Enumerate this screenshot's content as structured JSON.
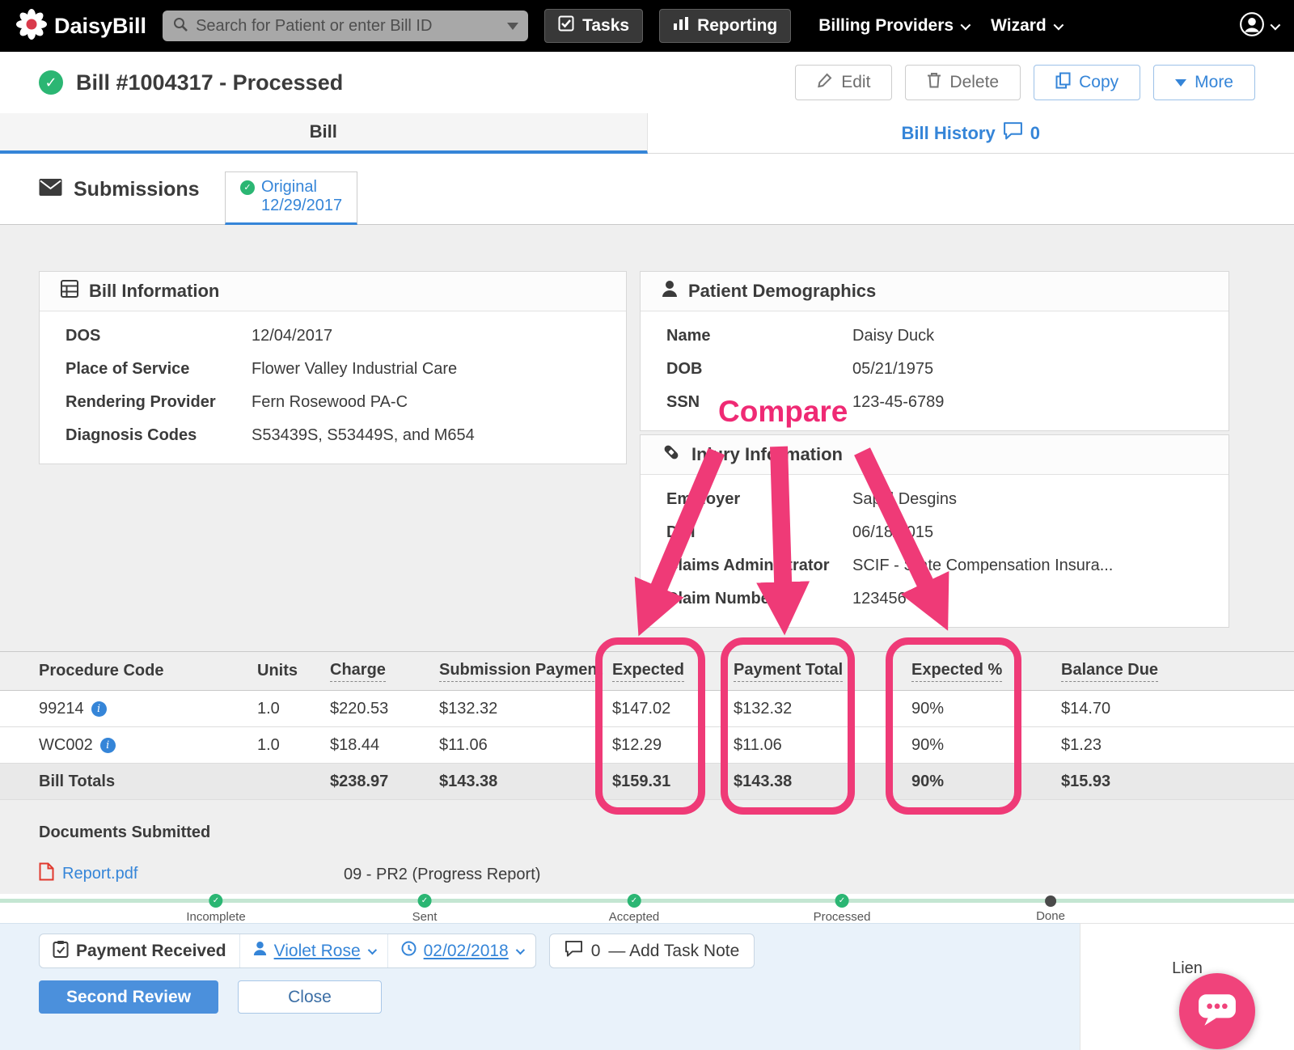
{
  "colors": {
    "accent_blue": "#3585d8",
    "annotation_pink": "#ef3a77",
    "status_green": "#2bb673",
    "topbar_black": "#000000"
  },
  "topbar": {
    "brand": "DaisyBill",
    "search_placeholder": "Search for Patient or enter Bill ID",
    "tasks": "Tasks",
    "reporting": "Reporting",
    "billing_providers": "Billing Providers",
    "wizard": "Wizard"
  },
  "header": {
    "title": "Bill #1004317 - Processed",
    "buttons": {
      "edit": "Edit",
      "delete": "Delete",
      "copy": "Copy",
      "more": "More"
    }
  },
  "tabs": {
    "bill": "Bill",
    "bill_history": "Bill History",
    "bill_history_count": "0"
  },
  "submissions": {
    "title": "Submissions",
    "original_label": "Original",
    "original_date": "12/29/2017"
  },
  "bill_information": {
    "title": "Bill Information",
    "rows": [
      {
        "label": "DOS",
        "value": "12/04/2017"
      },
      {
        "label": "Place of Service",
        "value": "Flower Valley Industrial Care"
      },
      {
        "label": "Rendering Provider",
        "value": "Fern Rosewood PA-C"
      },
      {
        "label": "Diagnosis Codes",
        "value": "S53439S, S53449S, and M654"
      }
    ]
  },
  "patient_demographics": {
    "title": "Patient Demographics",
    "rows": [
      {
        "label": "Name",
        "value": "Daisy Duck"
      },
      {
        "label": "DOB",
        "value": "05/21/1975"
      },
      {
        "label": "SSN",
        "value": "123-45-6789"
      }
    ]
  },
  "injury_information": {
    "title": "Injury Information",
    "rows": [
      {
        "label": "Employer",
        "value": "Sapid Desgins"
      },
      {
        "label": "DOI",
        "value": "06/18/2015"
      },
      {
        "label": "Claims Administrator",
        "value": "SCIF - State Compensation Insura..."
      },
      {
        "label": "Claim Number",
        "value": "123456"
      }
    ]
  },
  "annotation": {
    "compare": "Compare"
  },
  "procedure_table": {
    "headers": [
      "Procedure Code",
      "Units",
      "Charge",
      "Submission Payment",
      "Expected",
      "Payment Total",
      "Expected %",
      "Balance Due"
    ],
    "rows": [
      {
        "code": "99214",
        "units": "1.0",
        "charge": "$220.53",
        "submission_payment": "$132.32",
        "expected": "$147.02",
        "payment_total": "$132.32",
        "expected_pct": "90%",
        "balance_due": "$14.70"
      },
      {
        "code": "WC002",
        "units": "1.0",
        "charge": "$18.44",
        "submission_payment": "$11.06",
        "expected": "$12.29",
        "payment_total": "$11.06",
        "expected_pct": "90%",
        "balance_due": "$1.23"
      }
    ],
    "totals": {
      "label": "Bill Totals",
      "charge": "$238.97",
      "submission_payment": "$143.38",
      "expected": "$159.31",
      "payment_total": "$143.38",
      "expected_pct": "90%",
      "balance_due": "$15.93"
    }
  },
  "documents": {
    "title": "Documents Submitted",
    "file_name": "Report.pdf",
    "file_type": "09 - PR2 (Progress Report)"
  },
  "progress": {
    "steps": [
      {
        "label": "Incomplete",
        "state": "done"
      },
      {
        "label": "Sent",
        "state": "done"
      },
      {
        "label": "Accepted",
        "state": "done"
      },
      {
        "label": "Processed",
        "state": "done"
      },
      {
        "label": "Done",
        "state": "pending"
      }
    ]
  },
  "task_panel": {
    "payment_received": "Payment Received",
    "assignee": "Violet Rose",
    "due_date": "02/02/2018",
    "note_count": "0",
    "add_note": "— Add Task Note",
    "second_review": "Second Review",
    "close": "Close",
    "lien": "Lien"
  }
}
